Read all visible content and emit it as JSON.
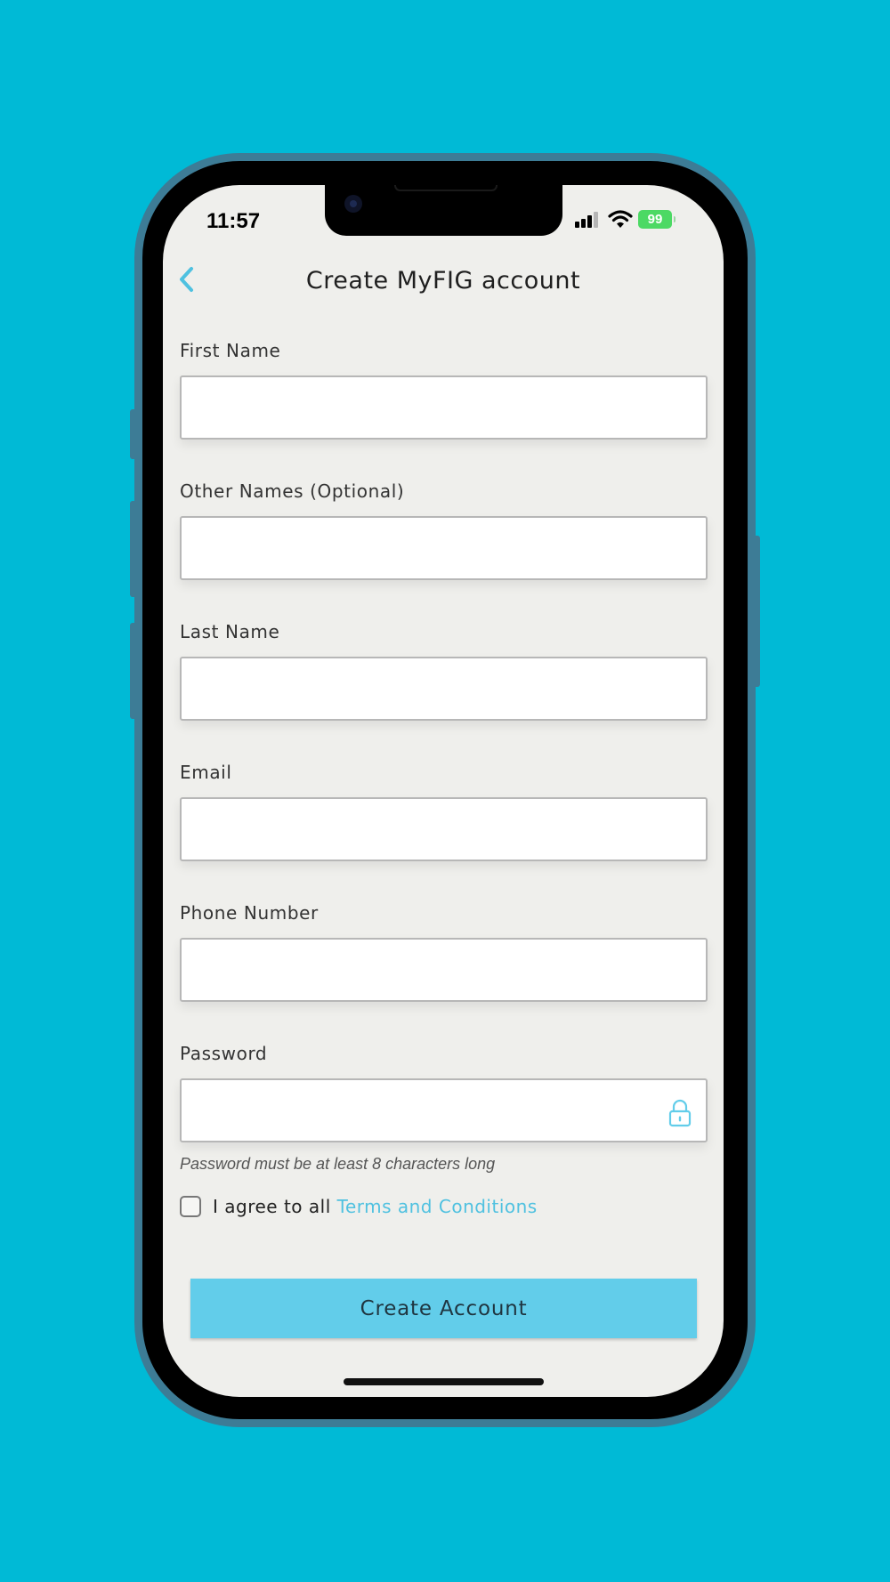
{
  "status_bar": {
    "time": "11:57",
    "battery": "99"
  },
  "header": {
    "title": "Create MyFIG account"
  },
  "form": {
    "fields": [
      {
        "label": "First Name",
        "value": ""
      },
      {
        "label": "Other Names (Optional)",
        "value": ""
      },
      {
        "label": "Last Name",
        "value": ""
      },
      {
        "label": "Email",
        "value": ""
      },
      {
        "label": "Phone Number",
        "value": ""
      },
      {
        "label": "Password",
        "value": ""
      }
    ],
    "password_hint": "Password must be at least 8 characters long",
    "agree_prefix": "I agree to all ",
    "terms_link": "Terms and Conditions",
    "submit_label": "Create Account"
  },
  "icons": {
    "back": "chevron-left-icon",
    "lock": "lock-icon",
    "signal": "signal-icon",
    "wifi": "wifi-icon",
    "battery": "battery-icon"
  },
  "colors": {
    "background": "#00BAD6",
    "accent": "#62CDEA",
    "link": "#4FC1E0",
    "screen": "#EFEFEC"
  }
}
